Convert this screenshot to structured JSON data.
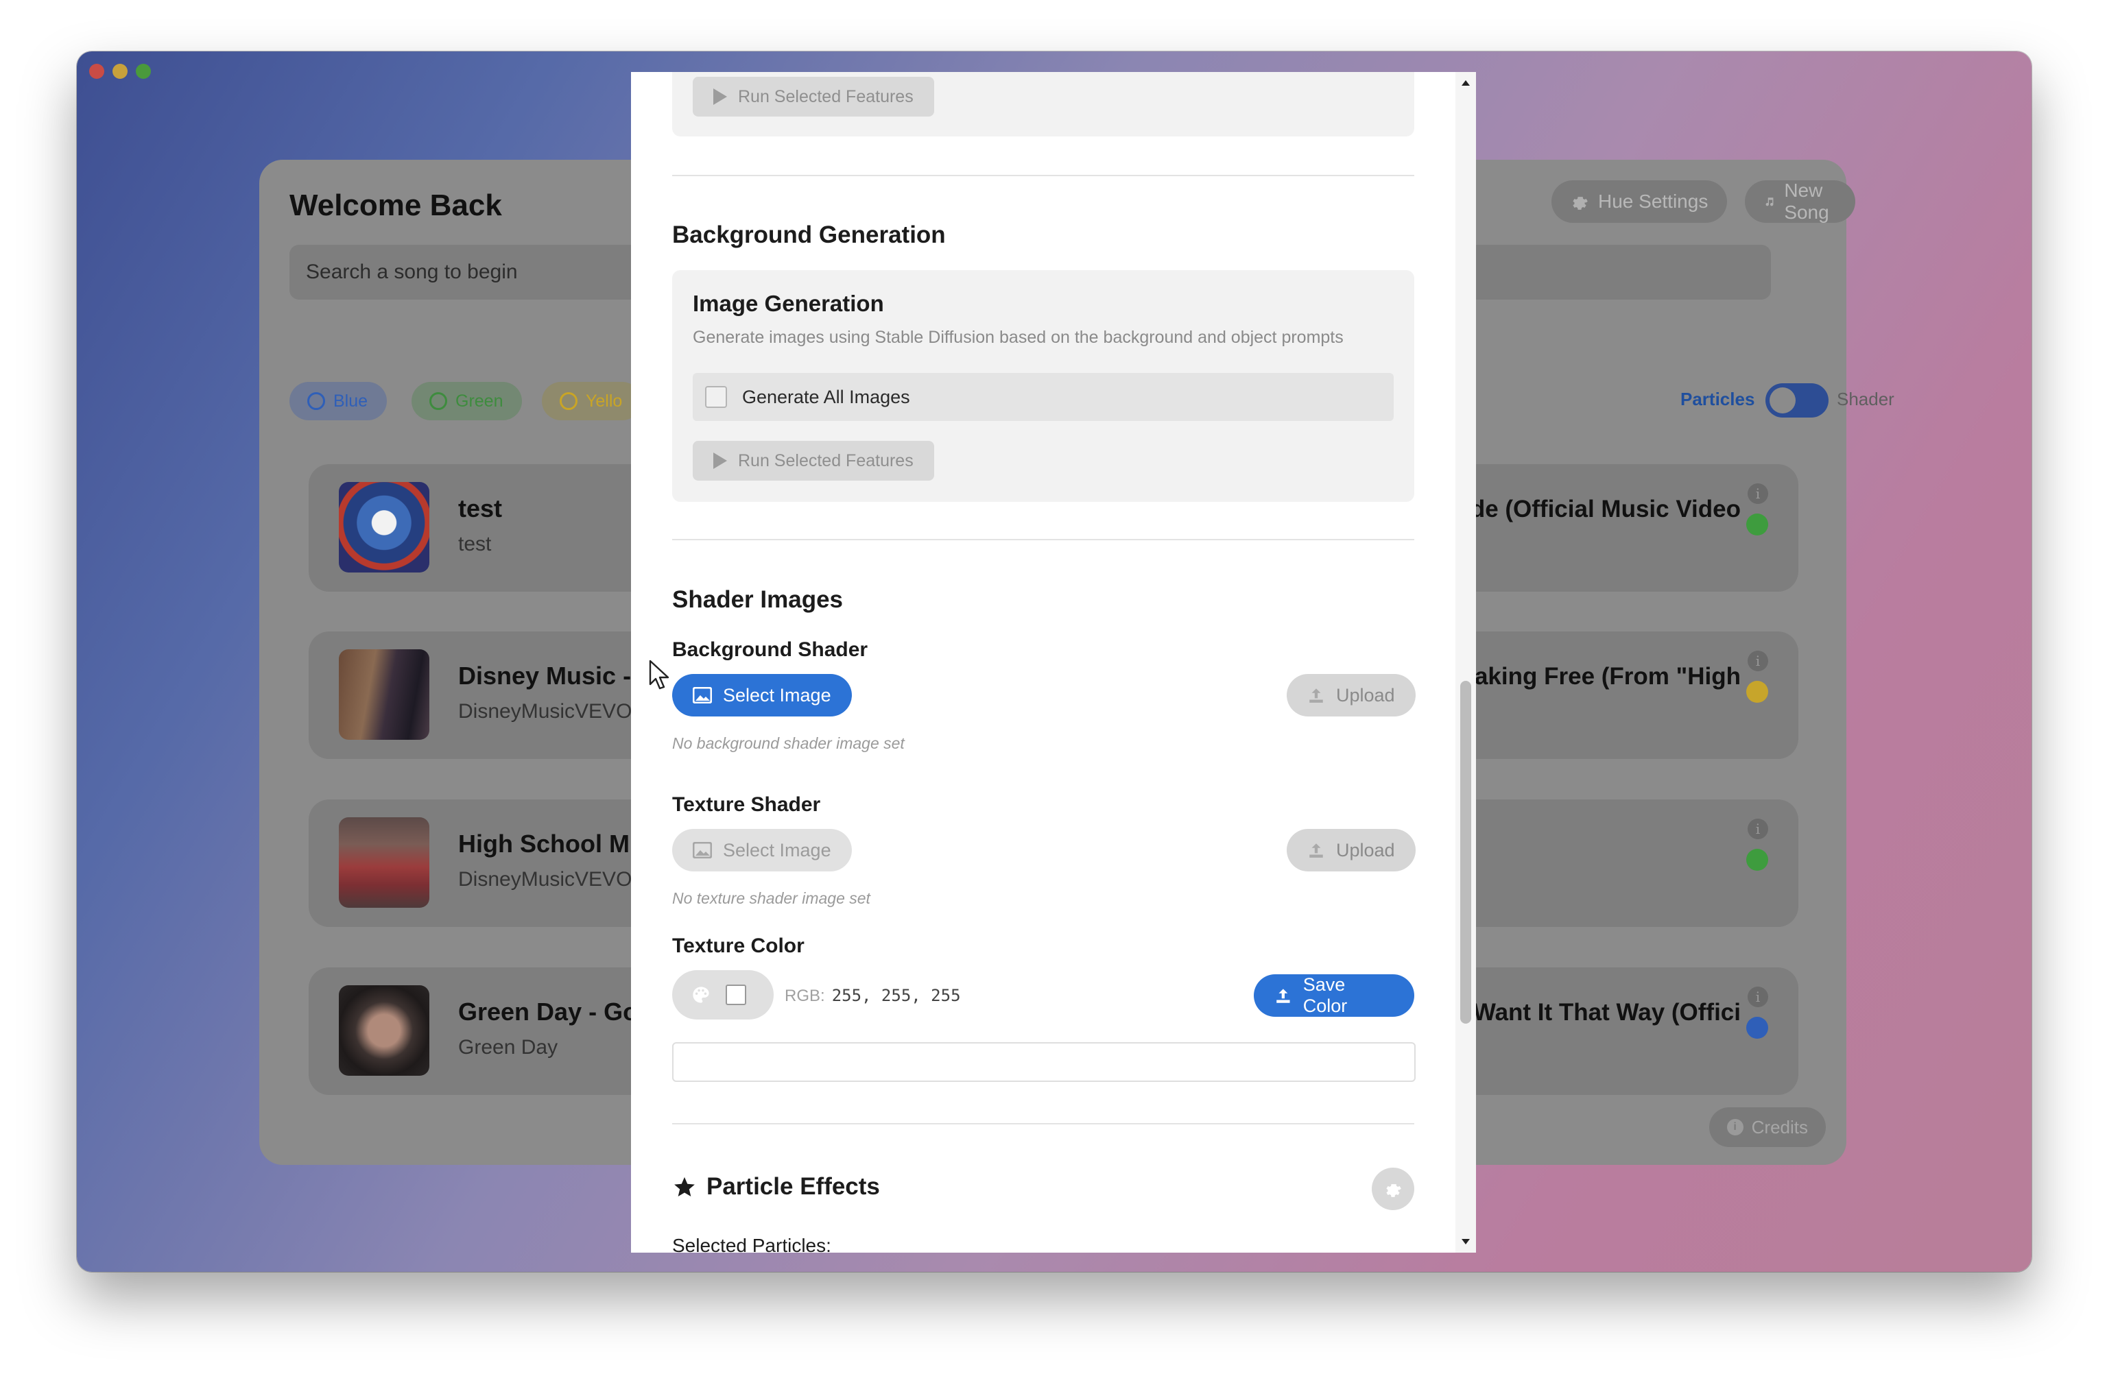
{
  "app": {
    "panel_title": "Welcome Back",
    "search_placeholder": "Search a song to begin",
    "hue_settings_label": "Hue Settings",
    "new_song_label": "New Song",
    "credits_label": "Credits",
    "chips": [
      {
        "label": "Blue",
        "color": "#2f5fb8"
      },
      {
        "label": "Green",
        "color": "#3e8c3e"
      },
      {
        "label": "Yello",
        "color": "#c9a526"
      }
    ],
    "toggle": {
      "left_label": "Particles",
      "right_label": "Shader",
      "active": "Particles"
    },
    "songs": [
      {
        "title": "test",
        "artist": "test",
        "right_title": "",
        "status_color": "#3e9c3e"
      },
      {
        "title": "Disney Music -",
        "artist": "DisneyMusicVEVO",
        "right_title": "aking Free (From \"High",
        "status_color": "#c7a52b"
      },
      {
        "title": "High School Mu",
        "artist": "DisneyMusicVEVO",
        "right_title": "",
        "status_color": "#3e9c3e"
      },
      {
        "title": "Green Day - Go",
        "artist": "Green Day",
        "right_title": "Want It That Way (Offici",
        "status_color": "#2f5fb8"
      }
    ],
    "song_first_right_title": "de (Official Music Video"
  },
  "modal": {
    "top_run_button": "Run Selected Features",
    "background_generation": {
      "heading": "Background Generation",
      "image_generation_title": "Image Generation",
      "image_generation_desc": "Generate images using Stable Diffusion based on the background and object prompts",
      "generate_all_label": "Generate All Images",
      "run_button": "Run Selected Features"
    },
    "shader_images": {
      "heading": "Shader Images",
      "background_shader": {
        "label": "Background Shader",
        "select_label": "Select Image",
        "upload_label": "Upload",
        "note": "No background shader image set"
      },
      "texture_shader": {
        "label": "Texture Shader",
        "select_label": "Select Image",
        "upload_label": "Upload",
        "note": "No texture shader image set"
      },
      "texture_color": {
        "label": "Texture Color",
        "rgb_prefix": "RGB:",
        "rgb_value": "255, 255, 255",
        "save_label": "Save Color"
      }
    },
    "particle_effects": {
      "heading": "Particle Effects",
      "selected_label": "Selected Particles:"
    }
  }
}
